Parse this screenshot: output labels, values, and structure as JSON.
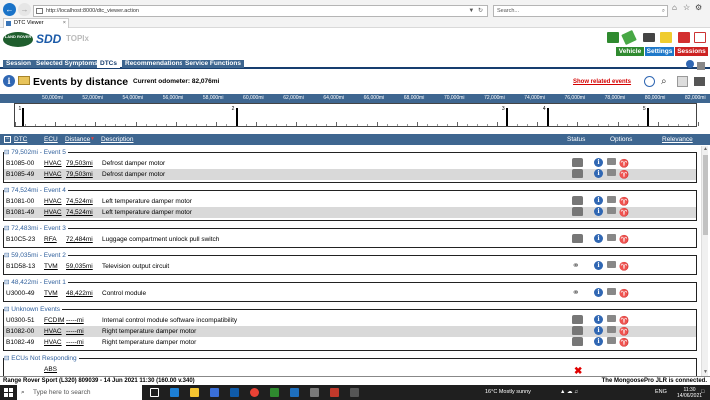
{
  "browser": {
    "url": "http://localhost:8000/dtc_viewer.action",
    "search_placeholder": "Search...",
    "tab_title": "DTC Viewer"
  },
  "app": {
    "logo_text": "LAND ROVER",
    "brand": "SDD",
    "product": "TOPIx",
    "header_buttons": {
      "vehicle": "Vehicle",
      "settings": "Settings",
      "sessions": "Sessions"
    }
  },
  "menu": {
    "items": [
      "Session",
      "Selected Symptoms",
      "DTCs",
      "Recommendations",
      "Service Functions"
    ],
    "active": "DTCs"
  },
  "events_header": {
    "title": "Events by distance",
    "odometer_label": "Current odometer:",
    "odometer_value": "82,076mi",
    "related_link": "Show related events"
  },
  "timeline": {
    "labels": [
      "50,000mi",
      "52,000mi",
      "54,000mi",
      "56,000mi",
      "58,000mi",
      "60,000mi",
      "62,000mi",
      "64,000mi",
      "66,000mi",
      "68,000mi",
      "70,000mi",
      "72,000mi",
      "74,000mi",
      "76,000mi",
      "78,000mi",
      "80,000mi",
      "82,000mi"
    ],
    "events": [
      {
        "num": "1",
        "mi": 48422
      },
      {
        "num": "2",
        "mi": 59035
      },
      {
        "num": "3",
        "mi": 72483
      },
      {
        "num": "4",
        "mi": 74524
      },
      {
        "num": "5",
        "mi": 79502
      }
    ]
  },
  "columns": {
    "dtc": "DTC",
    "ecu": "ECU",
    "distance": "Distance",
    "description": "Description",
    "status": "Status",
    "options": "Options",
    "relevance": "Relevance"
  },
  "groups": [
    {
      "title": "79,502mi - Event 5",
      "rows": [
        {
          "dtc": "B1085-00",
          "ecu": "HVAC",
          "distance": "79,503mi",
          "description": "Defrost damper motor",
          "status": "car"
        },
        {
          "dtc": "B1085-49",
          "ecu": "HVAC",
          "distance": "79,503mi",
          "description": "Defrost damper motor",
          "status": "car"
        }
      ]
    },
    {
      "title": "74,524mi - Event 4",
      "rows": [
        {
          "dtc": "B1081-00",
          "ecu": "HVAC",
          "distance": "74,524mi",
          "description": "Left temperature damper motor",
          "status": "car"
        },
        {
          "dtc": "B1081-49",
          "ecu": "HVAC",
          "distance": "74,524mi",
          "description": "Left temperature damper motor",
          "status": "car"
        }
      ]
    },
    {
      "title": "72,483mi - Event 3",
      "rows": [
        {
          "dtc": "B10C5-23",
          "ecu": "RFA",
          "distance": "72,484mi",
          "description": "Luggage compartment unlock pull switch",
          "status": "car"
        }
      ]
    },
    {
      "title": "59,035mi - Event 2",
      "rows": [
        {
          "dtc": "B1D58-13",
          "ecu": "TVM",
          "distance": "59,035mi",
          "description": "Television output circuit",
          "status": "link"
        }
      ]
    },
    {
      "title": "48,422mi - Event 1",
      "rows": [
        {
          "dtc": "U3000-49",
          "ecu": "TVM",
          "distance": "48,422mi",
          "description": "Control module",
          "status": "link"
        }
      ]
    },
    {
      "title": "Unknown Events",
      "rows": [
        {
          "dtc": "U0300-51",
          "ecu": "FCDIM",
          "distance": "-----mi",
          "description": "Internal control module software incompatibility",
          "status": "car"
        },
        {
          "dtc": "B1082-00",
          "ecu": "HVAC",
          "distance": "-----mi",
          "description": "Right temperature damper motor",
          "status": "car"
        },
        {
          "dtc": "B1082-49",
          "ecu": "HVAC",
          "distance": "-----mi",
          "description": "Right temperature damper motor",
          "status": "car"
        }
      ]
    },
    {
      "title": "ECUs Not Responding",
      "rows": [
        {
          "dtc": "",
          "ecu": "ABS",
          "distance": "",
          "description": "",
          "status": "x"
        }
      ]
    }
  ],
  "statusbar": {
    "left": "Range Rover Sport (L320) 809039 - 14 Jun 2021 11:30 (160.00 v.340)",
    "right": "The MongoosePro JLR is connected."
  },
  "taskbar": {
    "search_placeholder": "Type here to search",
    "weather": "16°C  Mostly sunny",
    "lang": "ENG",
    "time": "11:30",
    "date": "14/06/2021"
  },
  "colors": {
    "nav_blue": "#3e6690",
    "dark_blue": "#173e6f",
    "alert_red": "#d40000",
    "vehicle_green": "#2f8a2f",
    "settings_blue": "#1e78c9",
    "sessions_red": "#cc2222"
  }
}
